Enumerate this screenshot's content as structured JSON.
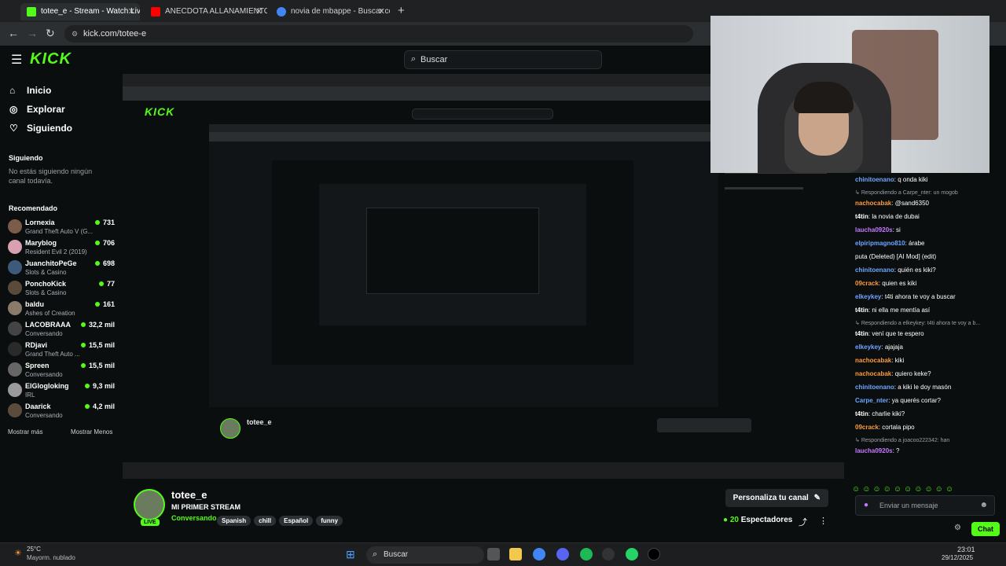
{
  "browser": {
    "tabs": [
      {
        "label": "totee_e - Stream - Watch Live or",
        "active": true
      },
      {
        "label": "ANECDOTA ALLANAMIENTO A",
        "active": false
      },
      {
        "label": "novia de mbappe - Buscar con",
        "active": false
      }
    ],
    "url": "kick.com/totee-e"
  },
  "kick": {
    "logo": "KICK",
    "search_placeholder": "Buscar",
    "nav": [
      {
        "label": "Inicio",
        "icon": "home-icon"
      },
      {
        "label": "Explorar",
        "icon": "compass-icon"
      },
      {
        "label": "Siguiendo",
        "icon": "heart-icon"
      }
    ],
    "following_title": "Siguiendo",
    "following_empty": "No estás siguiendo ningún canal todavía.",
    "recommended_title": "Recomendado",
    "recommended": [
      {
        "name": "Lornexia",
        "game": "Grand Theft Auto V (G...",
        "viewers": "731"
      },
      {
        "name": "Maryblog",
        "game": "Resident Evil 2 (2019)",
        "viewers": "706"
      },
      {
        "name": "JuanchitoPeGe",
        "game": "Slots & Casino",
        "viewers": "698"
      },
      {
        "name": "PonchoKick",
        "game": "Slots & Casino",
        "viewers": "77"
      },
      {
        "name": "baldu",
        "game": "Ashes of Creation",
        "viewers": "161"
      },
      {
        "name": "LACOBRAAA",
        "game": "Conversando",
        "viewers": "32,2 mil"
      },
      {
        "name": "RDjavi",
        "game": "Grand Theft Auto ...",
        "viewers": "15,5 mil"
      },
      {
        "name": "Spreen",
        "game": "Conversando",
        "viewers": "15,5 mil"
      },
      {
        "name": "ElGlogloking",
        "game": "IRL",
        "viewers": "9,3 mil"
      },
      {
        "name": "Daarick",
        "game": "Conversando",
        "viewers": "4,2 mil"
      }
    ],
    "show_more": "Mostrar más",
    "show_less": "Mostrar Menos"
  },
  "stream": {
    "channel": "totee_e",
    "title": "MI PRIMER STREAM",
    "category": "Conversando",
    "tags": [
      "Spanish",
      "chill",
      "Español",
      "funny"
    ],
    "live_badge": "LIVE",
    "customize_button": "Personaliza tu canal",
    "viewers": "20",
    "viewers_label": "Espectadores"
  },
  "chat": {
    "messages": [
      {
        "type": "msg",
        "user": "chinitoenano",
        "color": "#6ea6ff",
        "text": "q onda kiki"
      },
      {
        "type": "reply",
        "text": "Respondiendo a Carpe_nter: un mogob"
      },
      {
        "type": "msg",
        "user": "nachocabak",
        "color": "#ff9a3c",
        "text": "@sand6350"
      },
      {
        "type": "msg",
        "user": "t4tin",
        "color": "#ffffff",
        "text": "la novia de dubai"
      },
      {
        "type": "msg",
        "user": "laucha0920s",
        "color": "#c57bff",
        "text": "si"
      },
      {
        "type": "msg",
        "user": "elpiripmagno810",
        "color": "#6ea6ff",
        "text": "árabe"
      },
      {
        "type": "msg",
        "user": "",
        "color": "#ffffff",
        "text": "puta (Deleted) [AI Mod] (edit)"
      },
      {
        "type": "msg",
        "user": "chinitoenano",
        "color": "#6ea6ff",
        "text": "quién es kiki?"
      },
      {
        "type": "msg",
        "user": "09crack",
        "color": "#ff9a3c",
        "text": "quien es kiki"
      },
      {
        "type": "msg",
        "user": "elkeykey",
        "color": "#6ea6ff",
        "text": "t4ti ahora te voy a buscar"
      },
      {
        "type": "msg",
        "user": "t4tin",
        "color": "#ffffff",
        "text": "ni ella me mentía así"
      },
      {
        "type": "reply",
        "text": "Respondiendo a elkeykey: t4ti ahora te voy a b..."
      },
      {
        "type": "msg",
        "user": "t4tin",
        "color": "#ffffff",
        "text": "vení que te espero"
      },
      {
        "type": "msg",
        "user": "elkeykey",
        "color": "#6ea6ff",
        "text": "ajajaja"
      },
      {
        "type": "msg",
        "user": "nachocabak",
        "color": "#ff9a3c",
        "text": "kiki"
      },
      {
        "type": "msg",
        "user": "nachocabak",
        "color": "#ff9a3c",
        "text": "quiero keke?"
      },
      {
        "type": "msg",
        "user": "chinitoenano",
        "color": "#6ea6ff",
        "text": "a kiki le doy masón"
      },
      {
        "type": "msg",
        "user": "Carpe_nter",
        "color": "#6ea6ff",
        "text": "ya querés cortar?"
      },
      {
        "type": "msg",
        "user": "t4tin",
        "color": "#ffffff",
        "text": "charlie kiki?"
      },
      {
        "type": "msg",
        "user": "09crack",
        "color": "#ff9a3c",
        "text": "cortala pipo"
      },
      {
        "type": "reply",
        "text": "Respondiendo a joacoo222342: han"
      },
      {
        "type": "msg",
        "user": "laucha0920s",
        "color": "#c57bff",
        "text": "?"
      }
    ],
    "input_placeholder": "Enviar un mensaje",
    "send_button": "Chat"
  },
  "taskbar": {
    "weather_temp": "25°C",
    "weather_desc": "Mayorm. nublado",
    "search_label": "Buscar",
    "time": "23:01",
    "date": "29/12/2025"
  },
  "colors": {
    "accent": "#53fc18",
    "bg": "#0b0e0f"
  }
}
